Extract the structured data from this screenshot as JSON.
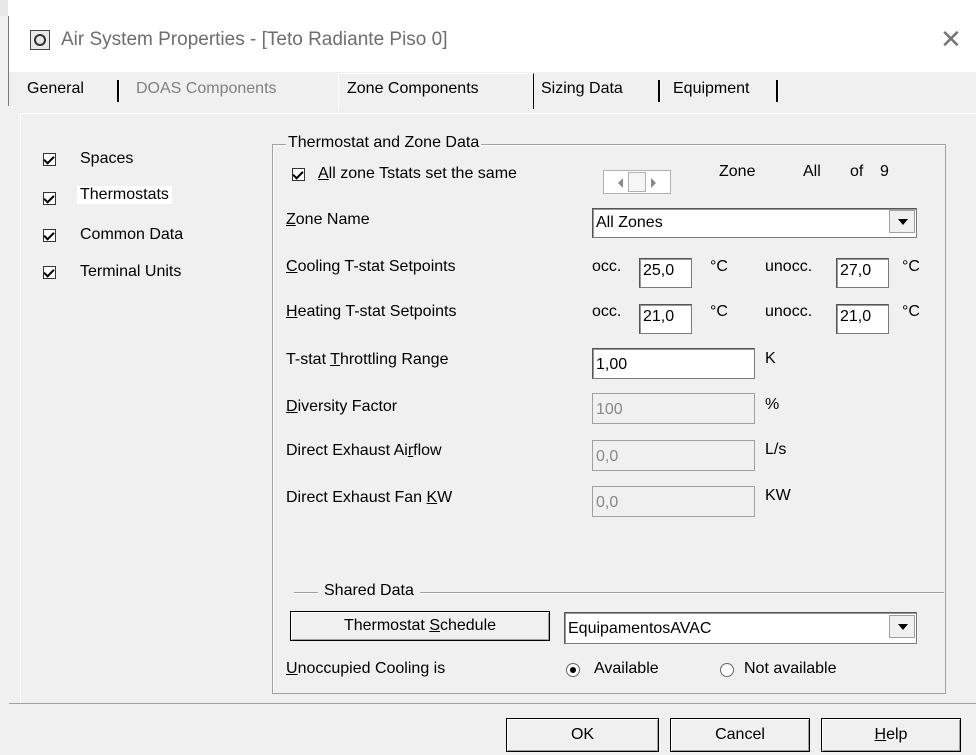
{
  "window": {
    "title": "Air System Properties - [Teto Radiante Piso 0]",
    "close_glyph": "✕",
    "icon": "app-window-icon"
  },
  "tabs": [
    {
      "label": "General",
      "state": "enabled"
    },
    {
      "label": "DOAS Components",
      "state": "disabled"
    },
    {
      "label": "Zone Components",
      "state": "selected"
    },
    {
      "label": "Sizing Data",
      "state": "enabled"
    },
    {
      "label": "Equipment",
      "state": "enabled"
    }
  ],
  "components": [
    {
      "label": "Spaces",
      "checked": true
    },
    {
      "label": "Thermostats",
      "checked": true,
      "focused": true
    },
    {
      "label": "Common Data",
      "checked": true
    },
    {
      "label": "Terminal Units",
      "checked": true
    }
  ],
  "thermostat": {
    "group_title": "Thermostat and Zone Data",
    "same_tstats_label_pre": "",
    "same_tstats_label_ul": "A",
    "same_tstats_label_post": "ll zone Tstats set the same",
    "same_tstats_checked": true,
    "zone_label": "Zone",
    "zone_value": "All",
    "zone_of": "of",
    "zone_count": "9",
    "zone_name_ul": "Z",
    "zone_name_rest": "one Name",
    "zone_name_value": "All Zones",
    "cooling_ul": "C",
    "cooling_rest": "ooling T-stat Setpoints",
    "heating_ul": "H",
    "heating_rest": "eating T-stat Setpoints",
    "occ_label": "occ.",
    "unocc_label": "unocc.",
    "deg_unit": "°C",
    "cooling_occ": "25,0",
    "cooling_unocc": "27,0",
    "heating_occ": "21,0",
    "heating_unocc": "21,0",
    "throttling_pre": "T-stat ",
    "throttling_ul": "T",
    "throttling_post": "hrottling Range",
    "throttling_value": "1,00",
    "throttling_unit": "K",
    "diversity_ul": "D",
    "diversity_rest": "iversity Factor",
    "diversity_value": "100",
    "diversity_unit": "%",
    "exhaust_airflow_pre": "Direct Exhaust Ai",
    "exhaust_airflow_ul": "r",
    "exhaust_airflow_post": "flow",
    "exhaust_airflow_value": "0,0",
    "exhaust_airflow_unit": "L/s",
    "exhaust_fan_pre": "Direct Exhaust Fan ",
    "exhaust_fan_ul": "K",
    "exhaust_fan_post": "W",
    "exhaust_fan_value": "0,0",
    "exhaust_fan_unit": "KW"
  },
  "shared": {
    "group_title": "Shared Data",
    "schedule_button_pre": "Thermostat ",
    "schedule_button_ul": "S",
    "schedule_button_post": "chedule",
    "schedule_value": "EquipamentosAVAC",
    "unocc_cooling_ul": "U",
    "unocc_cooling_rest": "noccupied Cooling is",
    "available_label": "Available",
    "not_available_label": "Not available",
    "selected_option": "Available"
  },
  "buttons": {
    "ok": "OK",
    "cancel": "Cancel",
    "help_ul": "H",
    "help_rest": "elp"
  }
}
